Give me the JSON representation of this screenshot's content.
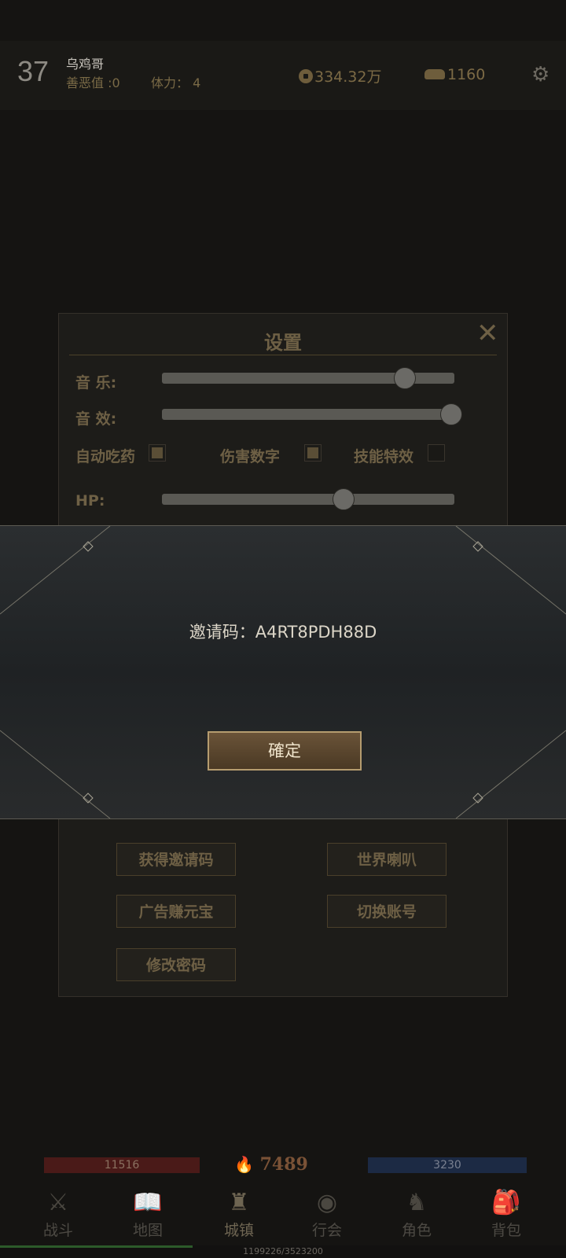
{
  "player": {
    "level": "37",
    "name": "乌鸡哥",
    "karma": "善恶值 :0",
    "stamina": "体力： 4",
    "coins": "334.32万",
    "ingots": "1160"
  },
  "settings": {
    "title": "设置",
    "music_label": "音 乐:",
    "music_level": 0.83,
    "sfx_label": "音 效:",
    "sfx_level": 1.0,
    "auto_potion": "自动吃药",
    "auto_potion_on": true,
    "damage_numbers": "伤害数字",
    "damage_numbers_on": true,
    "skill_effects": "技能特效",
    "skill_effects_on": false,
    "hp_label": "HP:",
    "hp_level": 0.62,
    "buttons": {
      "get_invite": "获得邀请码",
      "world_horn": "世界喇叭",
      "ad_ingot": "广告赚元宝",
      "switch_account": "切换账号",
      "change_password": "修改密码"
    }
  },
  "dialog": {
    "invite_text": "邀请码：A4RT8PDH88D",
    "confirm_label": "確定"
  },
  "status": {
    "hp": "11516",
    "mp": "3230",
    "power": "7489",
    "exp_text": "1199226/3523200",
    "exp_fraction": 0.34
  },
  "nav": [
    {
      "label": "战斗",
      "icon": "crossed-swords-icon"
    },
    {
      "label": "地图",
      "icon": "book-map-icon"
    },
    {
      "label": "城镇",
      "icon": "town-icon",
      "active": true
    },
    {
      "label": "行会",
      "icon": "guild-eye-icon"
    },
    {
      "label": "角色",
      "icon": "character-armor-icon"
    },
    {
      "label": "背包",
      "icon": "backpack-icon"
    }
  ]
}
